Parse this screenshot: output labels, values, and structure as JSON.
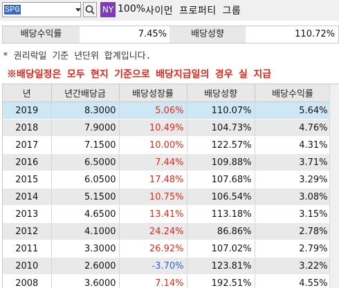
{
  "search": {
    "ticker": "SPG",
    "exchange": "NY",
    "zoom": "100%",
    "company": "사이먼 프로퍼티 그룹"
  },
  "summary": {
    "yield_label": "배당수익률",
    "yield_value": "7.45%",
    "payout_label": "배당성향",
    "payout_value": "110.72%"
  },
  "notes": {
    "line1": "* 권리락일 기준 년단위 합계입니다.",
    "line2": "※배당일정은 모두 현지 기준으로 배당지급일의 경우 실 지급"
  },
  "table": {
    "headers": [
      "년",
      "년간배당금",
      "배당성장률",
      "배당성향",
      "배당수익률"
    ],
    "rows": [
      {
        "year": "2019",
        "dividend": "8.3000",
        "growth": "5.06%",
        "growth_sign": "pos",
        "payout": "110.07%",
        "yield": "5.64%"
      },
      {
        "year": "2018",
        "dividend": "7.9000",
        "growth": "10.49%",
        "growth_sign": "pos",
        "payout": "104.73%",
        "yield": "4.76%"
      },
      {
        "year": "2017",
        "dividend": "7.1500",
        "growth": "10.00%",
        "growth_sign": "pos",
        "payout": "122.57%",
        "yield": "4.31%"
      },
      {
        "year": "2016",
        "dividend": "6.5000",
        "growth": "7.44%",
        "growth_sign": "pos",
        "payout": "109.88%",
        "yield": "3.71%"
      },
      {
        "year": "2015",
        "dividend": "6.0500",
        "growth": "17.48%",
        "growth_sign": "pos",
        "payout": "107.68%",
        "yield": "3.29%"
      },
      {
        "year": "2014",
        "dividend": "5.1500",
        "growth": "10.75%",
        "growth_sign": "pos",
        "payout": "106.54%",
        "yield": "3.08%"
      },
      {
        "year": "2013",
        "dividend": "4.6500",
        "growth": "13.41%",
        "growth_sign": "pos",
        "payout": "113.18%",
        "yield": "3.15%"
      },
      {
        "year": "2012",
        "dividend": "4.1000",
        "growth": "24.24%",
        "growth_sign": "pos",
        "payout": "86.86%",
        "yield": "2.78%"
      },
      {
        "year": "2011",
        "dividend": "3.3000",
        "growth": "26.92%",
        "growth_sign": "pos",
        "payout": "107.02%",
        "yield": "2.79%"
      },
      {
        "year": "2010",
        "dividend": "2.6000",
        "growth": "-3.70%",
        "growth_sign": "neg",
        "payout": "123.81%",
        "yield": "3.22%"
      },
      {
        "year": "2008",
        "dividend": "3.6000",
        "growth": "7.14%",
        "growth_sign": "pos",
        "payout": "192.51%",
        "yield": "4.55%"
      }
    ]
  },
  "colors": {
    "positive": "#e0281a",
    "negative": "#2f62d8",
    "selected_row": "#cde7f5",
    "exchange_badge": "#7d3bb6"
  }
}
